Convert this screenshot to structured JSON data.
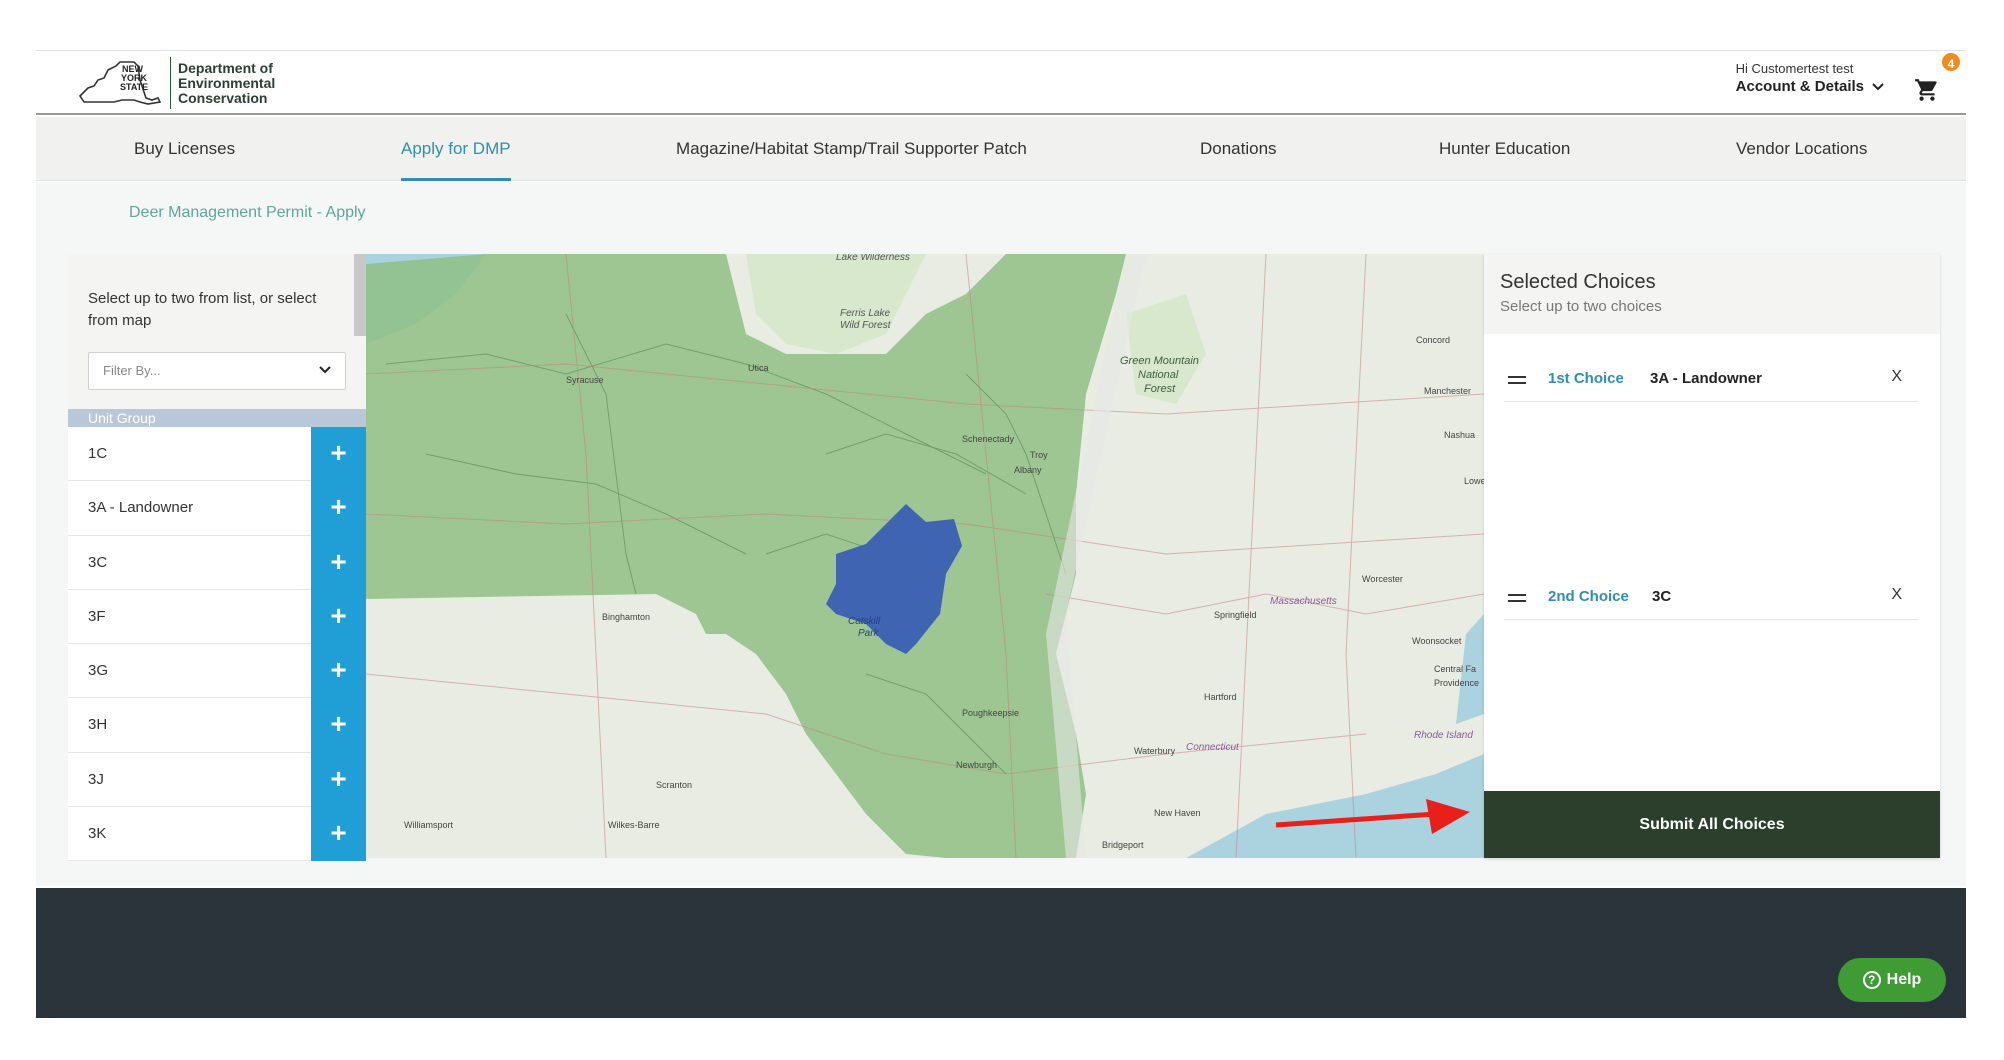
{
  "brand": {
    "state_line1": "NEW",
    "state_line2": "YORK",
    "state_line3": "STATE",
    "dept_line1": "Department of",
    "dept_line2": "Environmental",
    "dept_line3": "Conservation"
  },
  "account": {
    "greeting": "Hi Customertest test",
    "label": "Account & Details",
    "cart_count": "4"
  },
  "nav": {
    "items": [
      {
        "label": "Buy Licenses"
      },
      {
        "label": "Apply for DMP"
      },
      {
        "label": "Magazine/Habitat Stamp/Trail Supporter Patch"
      },
      {
        "label": "Donations"
      },
      {
        "label": "Hunter Education"
      },
      {
        "label": "Vendor Locations"
      }
    ],
    "active": "Apply for DMP"
  },
  "breadcrumb": "Deer Management Permit - Apply",
  "unit_panel": {
    "instructions": "Select up to two from list, or select from map",
    "filter_placeholder": "Filter By...",
    "group_header": "Unit Group",
    "units": [
      "1C",
      "3A - Landowner",
      "3C",
      "3F",
      "3G",
      "3H",
      "3J",
      "3K"
    ],
    "add_symbol": "+"
  },
  "map": {
    "labels": {
      "lake_wilderness": "Lake Wilderness",
      "ferris_lake": "Ferris Lake",
      "wild_forest": "Wild Forest",
      "green_mountain_1": "Green Mountain",
      "green_mountain_2": "National",
      "green_mountain_3": "Forest",
      "syracuse": "Syracuse",
      "utica": "Utica",
      "schenectady": "Schenectady",
      "troy": "Troy",
      "albany": "Albany",
      "concord": "Concord",
      "manchester": "Manchester",
      "nashua": "Nashua",
      "lowell": "Lowe",
      "worcester": "Worcester",
      "massachusetts": "Massachusetts",
      "woonsocket": "Woonsocket",
      "central_falls": "Central Fa",
      "providence": "Providence",
      "rhode_island": "Rhode Island",
      "springfield": "Springfield",
      "hartford": "Hartford",
      "connecticut": "Connecticut",
      "waterbury": "Waterbury",
      "new_haven": "New Haven",
      "bridgeport": "Bridgeport",
      "binghamton": "Binghamton",
      "catskill_1": "Catskill",
      "catskill_2": "Park",
      "poughkeepsie": "Poughkeepsie",
      "newburgh": "Newburgh",
      "scranton": "Scranton",
      "wilkes_barre": "Wilkes-Barre",
      "williamsport": "Williamsport"
    }
  },
  "selected": {
    "title": "Selected Choices",
    "subtitle": "Select up to two choices",
    "choices": [
      {
        "rank": "1st Choice",
        "value": "3A - Landowner",
        "remove": "X"
      },
      {
        "rank": "2nd Choice",
        "value": "3C",
        "remove": "X"
      }
    ],
    "submit_label": "Submit All Choices"
  },
  "help": {
    "label": "Help",
    "icon_glyph": "?"
  },
  "colors": {
    "accent": "#2f8fae",
    "add_button": "#1f9fd6",
    "submit": "#2c3f2c",
    "footer": "#2b333b",
    "help": "#3f9c35",
    "badge": "#f08a1a",
    "map_region": "#8fbf85",
    "map_selected": "#3a5fb3",
    "arrow": "#e8201a"
  }
}
